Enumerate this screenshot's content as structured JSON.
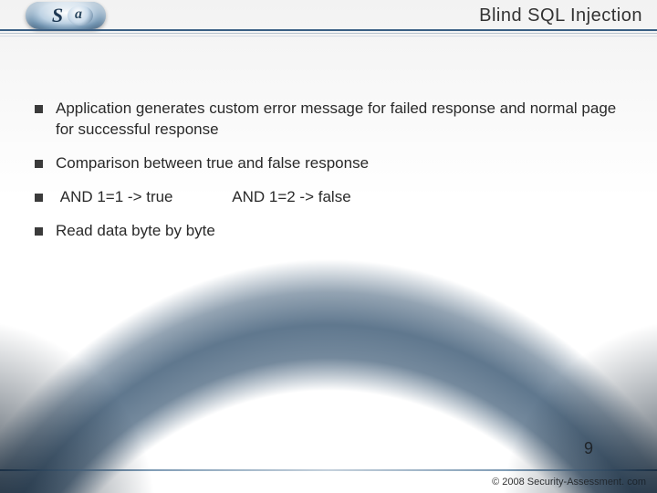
{
  "logo": {
    "letter1": "S",
    "letter2": "a"
  },
  "title": "Blind SQL Injection",
  "bullets": [
    "Application generates custom error message for failed response and normal page for successful response",
    "Comparison between true and false response"
  ],
  "examples": {
    "true_ex": "AND 1=1  -> true",
    "false_ex": "AND 1=2 -> false"
  },
  "bullet_last": "Read data byte by byte",
  "page_number": "9",
  "footer": "© 2008 Security-Assessment. com"
}
